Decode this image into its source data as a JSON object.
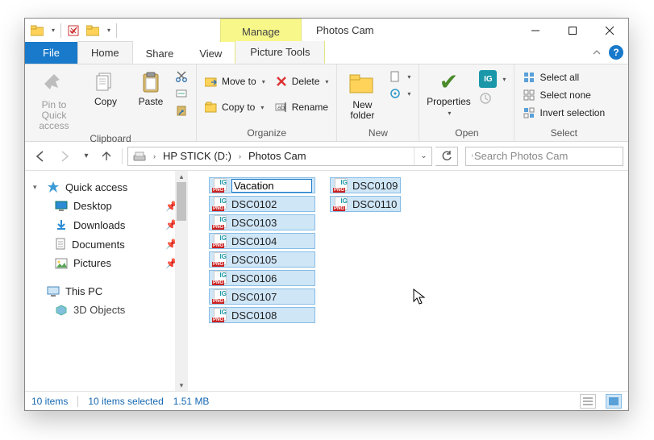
{
  "titlebar": {
    "manage": "Manage",
    "title": "Photos Cam"
  },
  "tabs": {
    "file": "File",
    "home": "Home",
    "share": "Share",
    "view": "View",
    "picture_tools": "Picture Tools"
  },
  "ribbon": {
    "clipboard": {
      "label": "Clipboard",
      "pin": "Pin to Quick access",
      "copy": "Copy",
      "paste": "Paste"
    },
    "organize": {
      "label": "Organize",
      "move_to": "Move to",
      "copy_to": "Copy to",
      "delete": "Delete",
      "rename": "Rename"
    },
    "new": {
      "label": "New",
      "new_folder": "New folder"
    },
    "open": {
      "label": "Open",
      "properties": "Properties"
    },
    "select": {
      "label": "Select",
      "select_all": "Select all",
      "select_none": "Select none",
      "invert": "Invert selection"
    }
  },
  "address": {
    "seg1": "HP STICK (D:)",
    "seg2": "Photos Cam"
  },
  "search": {
    "placeholder": "Search Photos Cam"
  },
  "nav": {
    "quick_access": "Quick access",
    "desktop": "Desktop",
    "downloads": "Downloads",
    "documents": "Documents",
    "pictures": "Pictures",
    "this_pc": "This PC",
    "3d_objects": "3D Objects"
  },
  "files": {
    "rename_value": "Vacation",
    "col1": [
      "DSC0102",
      "DSC0103",
      "DSC0104",
      "DSC0105",
      "DSC0106",
      "DSC0107",
      "DSC0108"
    ],
    "col2": [
      "DSC0109",
      "DSC0110"
    ]
  },
  "status": {
    "items": "10 items",
    "selected": "10 items selected",
    "size": "1.51 MB"
  }
}
